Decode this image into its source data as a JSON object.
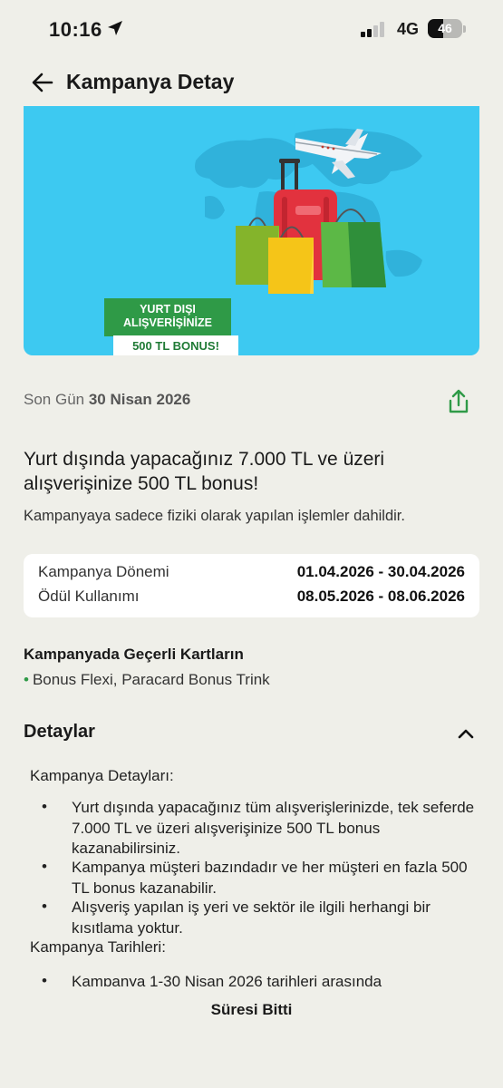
{
  "status_bar": {
    "time": "10:16",
    "network": "4G",
    "battery_level": "46"
  },
  "header": {
    "title": "Kampanya Detay",
    "back_icon": "arrow-left-icon"
  },
  "banner": {
    "line1": "YURT DIŞI",
    "line2": "ALIŞVERİŞİNİZE",
    "bonus": "500 TL BONUS!"
  },
  "campaign": {
    "last_day_label": "Son Gün",
    "last_day_value": "30 Nisan 2026",
    "headline": "Yurt dışında yapacağınız 7.000 TL ve üzeri alışverişinize 500 TL bonus!",
    "subline": "Kampanyaya sadece fiziki olarak yapılan işlemler dahildir."
  },
  "period": {
    "rows": [
      {
        "label": "Kampanya Dönemi",
        "value": "01.04.2026 - 30.04.2026"
      },
      {
        "label": "Ödül Kullanımı",
        "value": "08.05.2026 - 08.06.2026"
      }
    ]
  },
  "valid_cards": {
    "title": "Kampanyada Geçerli Kartların",
    "items": [
      "Bonus Flexi, Paracard Bonus Trink"
    ]
  },
  "details": {
    "title": "Detaylar",
    "section1_title": "Kampanya Detayları:",
    "bullets": [
      "Yurt dışında yapacağınız tüm alışverişlerinizde, tek seferde 7.000 TL ve üzeri alışverişinize  500 TL bonus kazanabilirsiniz.",
      "Kampanya müşteri bazındadır ve her müşteri en fazla 500 TL bonus kazanabilir.",
      "Alışveriş yapılan iş yeri ve sektör ile ilgili herhangi bir kısıtlama yoktur."
    ],
    "section2_title": "Kampanya Tarihleri:",
    "dates_bullet": "Kampanya 1-30 Nisan 2026 tarihleri arasında"
  },
  "footer": {
    "status": "Süresi Bitti"
  },
  "colors": {
    "background": "#efefe9",
    "banner_bg": "#3dc9f1",
    "accent_green": "#2f9a47"
  }
}
